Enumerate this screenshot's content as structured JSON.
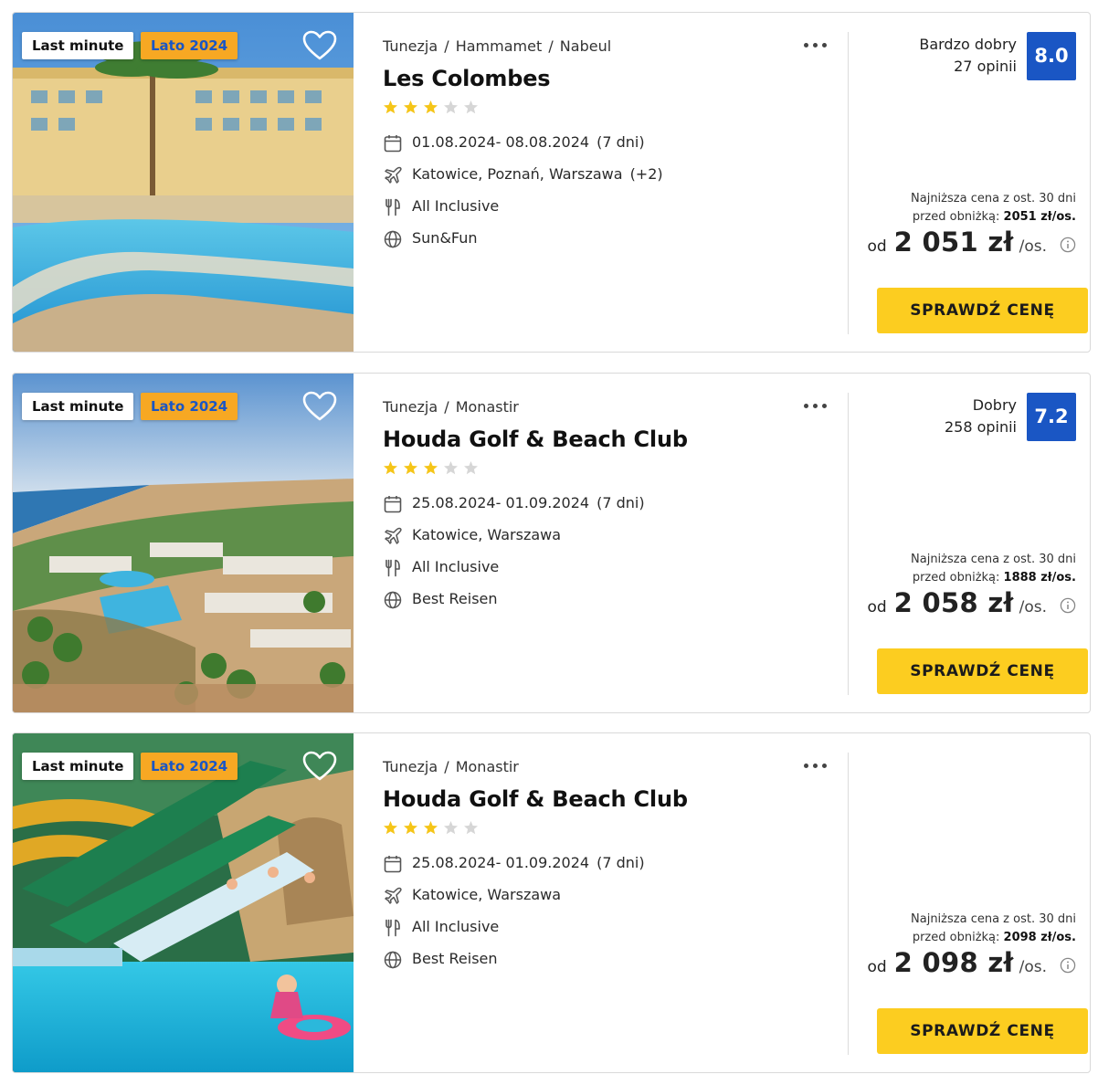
{
  "colors": {
    "rating_blue": "#1a56c4",
    "season_badge_bg": "#f7a823",
    "season_badge_text": "#1a56c4",
    "cta_yellow": "#fccd20",
    "star_filled": "#f5c518",
    "star_empty": "#d6d6d6"
  },
  "icons": {
    "favorite": "heart-outline-icon",
    "menu": "more-dots-icon",
    "dates": "calendar-icon",
    "flights": "plane-icon",
    "board": "fork-knife-icon",
    "operator": "globe-icon",
    "info": "info-circle-icon"
  },
  "offers": [
    {
      "badges": {
        "last_minute": "Last minute",
        "season": "Lato 2024"
      },
      "location": {
        "country": "Tunezja",
        "sep1": "/",
        "city": "Hammamet",
        "sep2": "/",
        "region": "Nabeul"
      },
      "name": "Les Colombes",
      "stars": {
        "rating": 3,
        "max": 5
      },
      "dates": "01.08.2024- 08.08.2024",
      "duration": "(7 dni)",
      "departures": "Katowice, Poznań, Warszawa",
      "departures_more": "(+2)",
      "board": "All Inclusive",
      "operator": "Sun&Fun",
      "rating": {
        "label": "Bardzo dobry",
        "reviews": "27 opinii",
        "score": "8.0"
      },
      "lowest_price": {
        "line1": "Najniższa cena z ost. 30 dni",
        "line2_prefix": "przed obniżką:",
        "value": "2051 zł/os."
      },
      "price": {
        "from": "od",
        "amount": "2 051 zł",
        "per": "/os."
      },
      "cta_label": "SPRAWDŹ CENĘ"
    },
    {
      "badges": {
        "last_minute": "Last minute",
        "season": "Lato 2024"
      },
      "location": {
        "country": "Tunezja",
        "sep1": "/",
        "city": "Monastir"
      },
      "name": "Houda Golf & Beach Club",
      "stars": {
        "rating": 3,
        "max": 5
      },
      "dates": "25.08.2024- 01.09.2024",
      "duration": "(7 dni)",
      "departures": "Katowice, Warszawa",
      "board": "All Inclusive",
      "operator": "Best Reisen",
      "rating": {
        "label": "Dobry",
        "reviews": "258 opinii",
        "score": "7.2"
      },
      "lowest_price": {
        "line1": "Najniższa cena z ost. 30 dni",
        "line2_prefix": "przed obniżką:",
        "value": "1888 zł/os."
      },
      "price": {
        "from": "od",
        "amount": "2 058 zł",
        "per": "/os."
      },
      "cta_label": "SPRAWDŹ CENĘ"
    },
    {
      "badges": {
        "last_minute": "Last minute",
        "season": "Lato 2024"
      },
      "location": {
        "country": "Tunezja",
        "sep1": "/",
        "city": "Monastir"
      },
      "name": "Houda Golf & Beach Club",
      "stars": {
        "rating": 3,
        "max": 5
      },
      "dates": "25.08.2024- 01.09.2024",
      "duration": "(7 dni)",
      "departures": "Katowice, Warszawa",
      "board": "All Inclusive",
      "operator": "Best Reisen",
      "lowest_price": {
        "line1": "Najniższa cena z ost. 30 dni",
        "line2_prefix": "przed obniżką:",
        "value": "2098 zł/os."
      },
      "price": {
        "from": "od",
        "amount": "2 098 zł",
        "per": "/os."
      },
      "cta_label": "SPRAWDŹ CENĘ"
    }
  ]
}
